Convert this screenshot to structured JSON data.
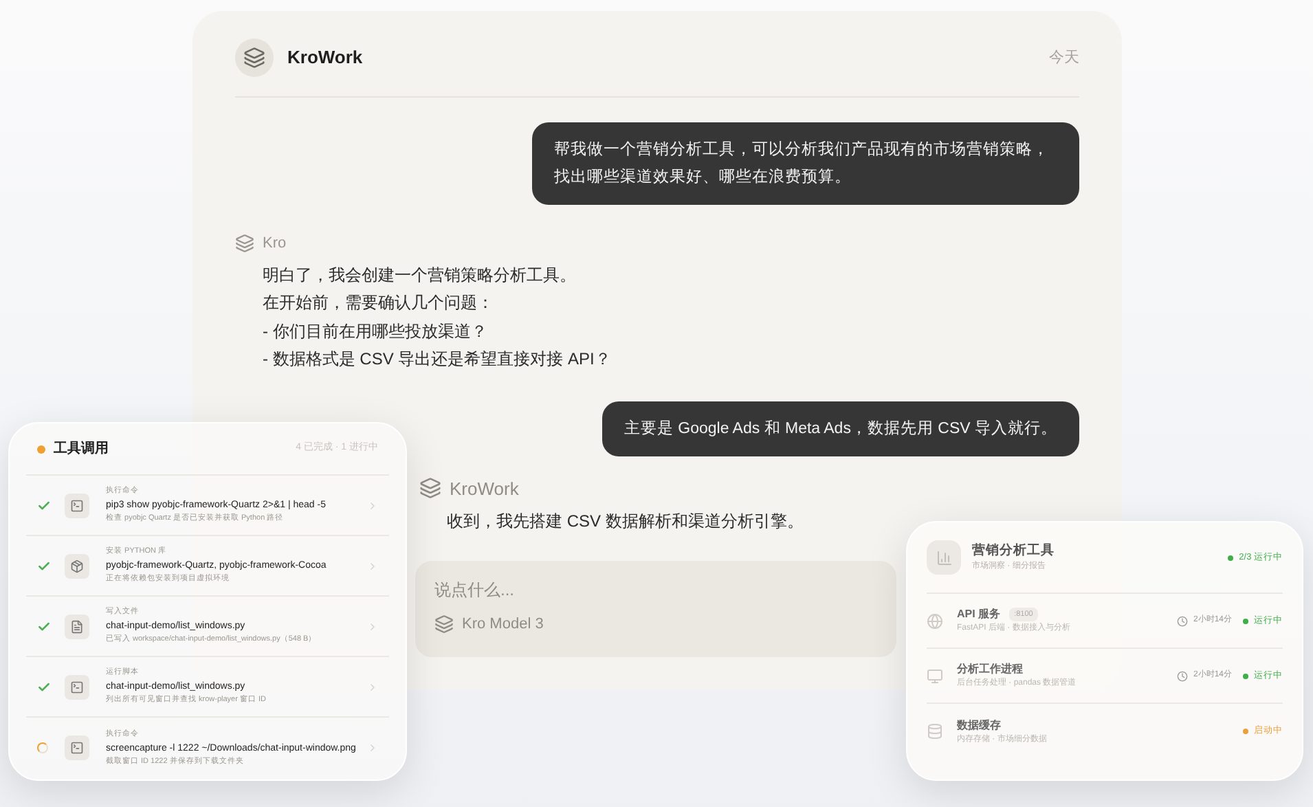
{
  "chat": {
    "app_name": "KroWork",
    "date": "今天",
    "messages": [
      {
        "kind": "user",
        "text": "帮我做一个营销分析工具，可以分析我们产品现有的市场营销策略，找出哪些渠道效果好、哪些在浪费预算。"
      },
      {
        "kind": "assistant",
        "sender": "Kro",
        "lines": [
          "明白了，我会创建一个营销策略分析工具。",
          "在开始前，需要确认几个问题：",
          "- 你们目前在用哪些投放渠道？",
          "- 数据格式是 CSV 导出还是希望直接对接 API？"
        ]
      },
      {
        "kind": "user",
        "text": "主要是 Google Ads 和 Meta Ads，数据先用 CSV 导入就行。"
      },
      {
        "kind": "assistant",
        "sender": "KroWork",
        "lines": [
          "收到，我先搭建 CSV 数据解析和渠道分析引擎。"
        ]
      }
    ],
    "input": {
      "placeholder": "说点什么...",
      "model": "Kro Model 3"
    }
  },
  "tool_panel": {
    "title": "工具调用",
    "summary": "4 已完成 · 1 进行中",
    "items": [
      {
        "completed": true,
        "label": "执行命令",
        "command": "pip3 show pyobjc-framework-Quartz 2>&1 | head -5",
        "detail": "检查 pyobjc Quartz 是否已安装并获取 Python 路径"
      },
      {
        "completed": true,
        "label": "安装 PYTHON 库",
        "command": "pyobjc-framework-Quartz, pyobjc-framework-Cocoa",
        "detail": "正在将依赖包安装到项目虚拟环境"
      },
      {
        "completed": true,
        "label": "写入文件",
        "command": "chat-input-demo/list_windows.py",
        "detail": "已写入 workspace/chat-input-demo/list_windows.py（548 B）"
      },
      {
        "completed": true,
        "label": "运行脚本",
        "command": "chat-input-demo/list_windows.py",
        "detail": "列出所有可见窗口并查找 krow-player 窗口 ID"
      },
      {
        "completed": false,
        "label": "执行命令",
        "command": "screencapture -l 1222 ~/Downloads/chat-input-window.png",
        "detail": "截取窗口 ID 1222 并保存到下载文件夹"
      }
    ]
  },
  "service_panel": {
    "title": "营销分析工具",
    "subtitle": "市场洞察 · 细分报告",
    "status": {
      "text": "2/3 运行中",
      "color": "#3fae4a"
    },
    "services": [
      {
        "name": "API 服务",
        "port": ":8100",
        "description": "FastAPI 后端 · 数据接入与分析",
        "uptime": "2小时14分",
        "status": "运行中",
        "color": "#3fae4a"
      },
      {
        "name": "分析工作进程",
        "description": "后台任务处理 · pandas 数据管道",
        "uptime": "2小时14分",
        "status": "运行中",
        "color": "#3fae4a"
      },
      {
        "name": "数据缓存",
        "description": "内存存储 · 市场细分数据",
        "status": "启动中",
        "color": "#e9a23b"
      }
    ]
  }
}
